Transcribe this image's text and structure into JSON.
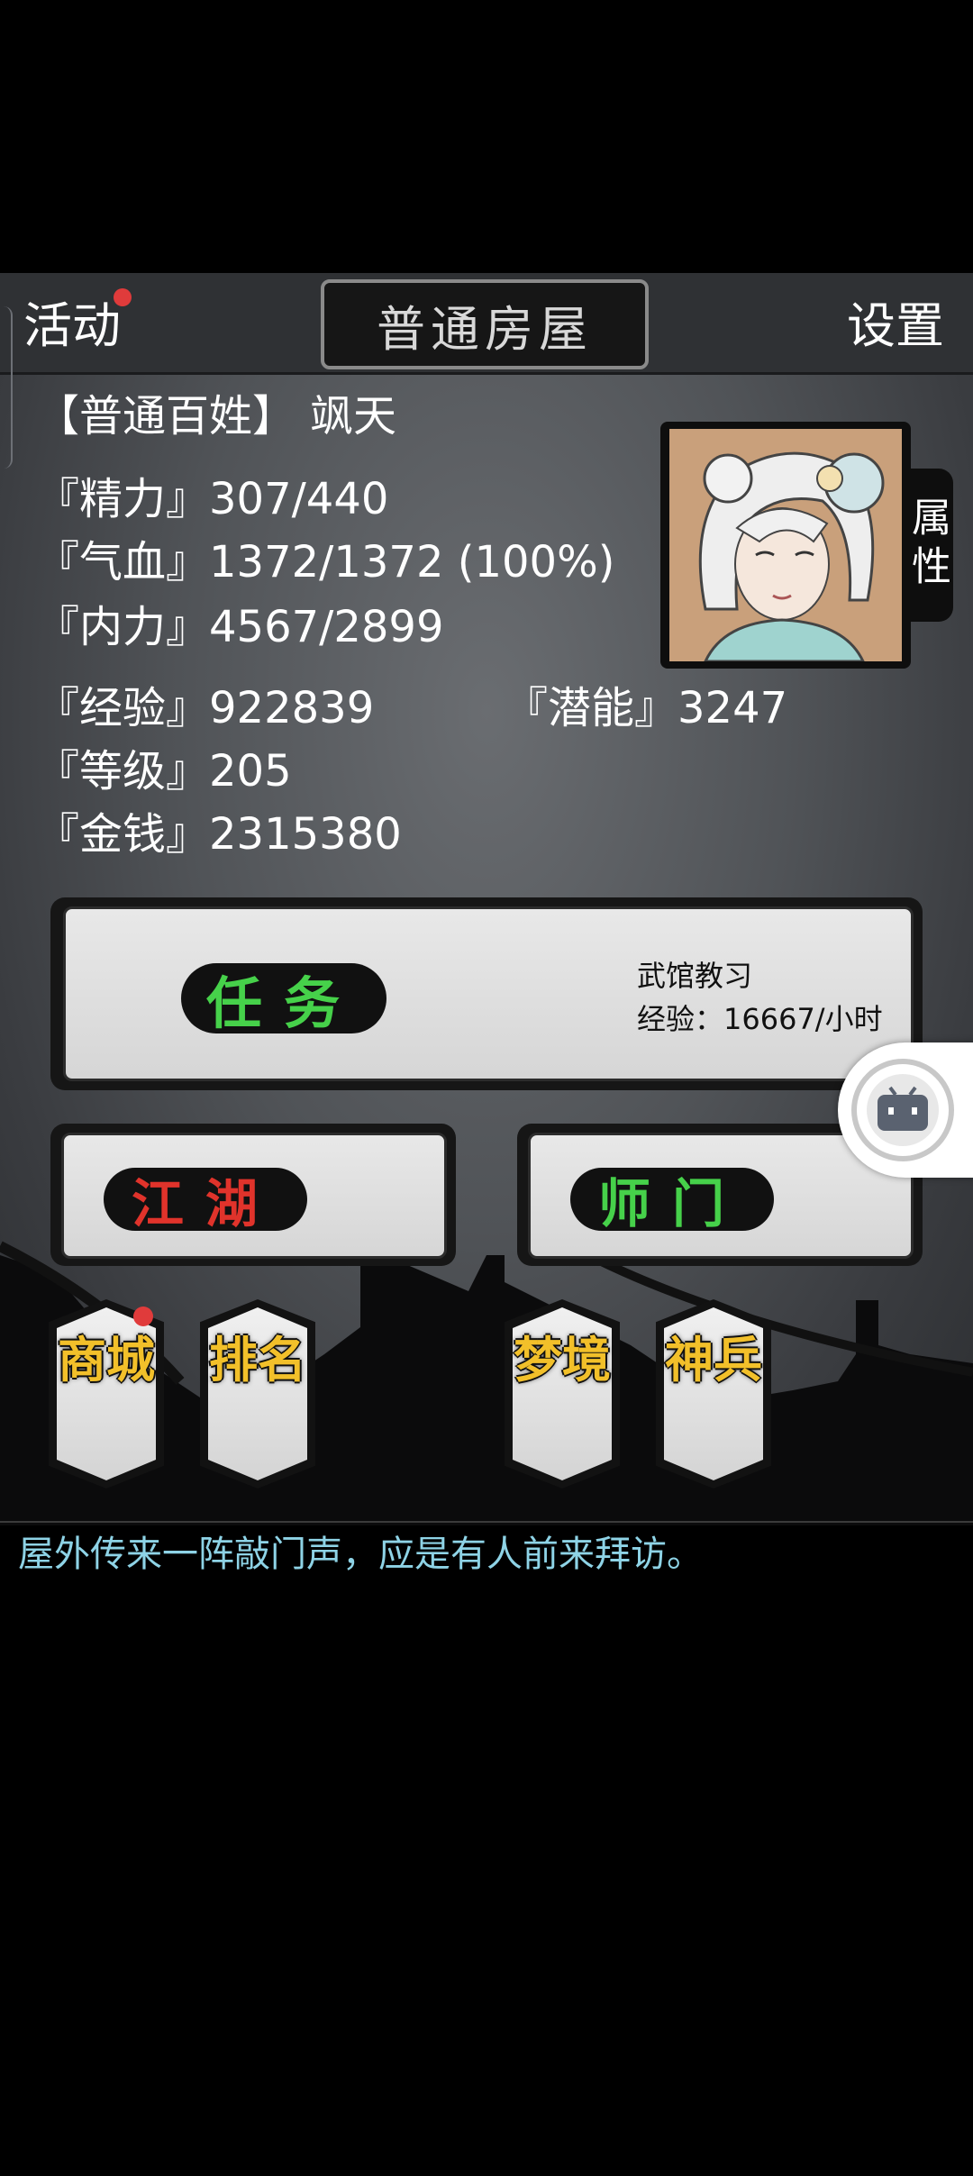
{
  "topbar": {
    "activity_label": "活动",
    "room_title": "普通房屋",
    "settings_label": "设置"
  },
  "player": {
    "rank": "【普通百姓】",
    "name": "飒天"
  },
  "stats": {
    "energy": "『精力』307/440",
    "hp": "『气血』1372/1372 (100%)",
    "inner_power": "『内力』4567/2899",
    "experience": "『经验』922839",
    "potential": "『潜能』3247",
    "level": "『等级』205",
    "money": "『金钱』2315380"
  },
  "attributes_tab": "属性",
  "task": {
    "button_label": "任务",
    "activity_name": "武馆教习",
    "exp_rate": "经验：16667/小时"
  },
  "main_buttons": {
    "jianghu": "江湖",
    "shimen": "师门"
  },
  "small_buttons": {
    "shop": "商城",
    "ranking": "排名",
    "dream": "梦境",
    "weapon": "神兵"
  },
  "message": "屋外传来一阵敲门声，应是有人前来拜访。",
  "colors": {
    "notification_dot": "#e03b3b",
    "green_text": "#46d14a",
    "red_text": "#e0332b",
    "gold_text": "#f2c02a",
    "message_text": "#8ed3e6"
  }
}
